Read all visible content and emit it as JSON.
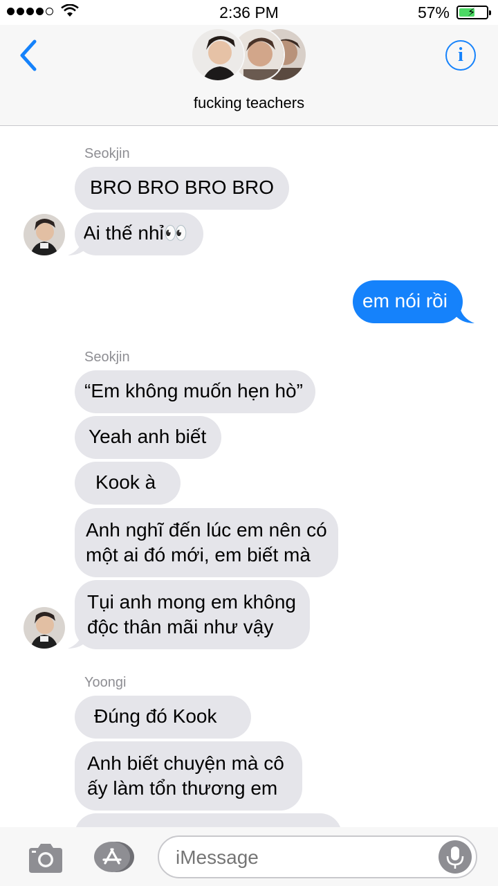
{
  "status_bar": {
    "time": "2:36 PM",
    "battery_percent": "57%",
    "battery_level": 0.57,
    "signal_bars_filled": 4,
    "signal_bars_total": 5
  },
  "header": {
    "group_name": "fucking teachers",
    "back_icon": "chevron-left-icon",
    "info_icon": "info-icon",
    "info_label": "i"
  },
  "thread": {
    "group1": {
      "sender": "Seokjin",
      "messages": [
        "BRO BRO BRO BRO",
        "Ai thế nhỉ👀"
      ]
    },
    "outgoing1": "em nói rồi",
    "group2": {
      "sender": "Seokjin",
      "messages": [
        "“Em không muốn hẹn hò”",
        "Yeah anh biết",
        "Kook à",
        "Anh nghĩ đến lúc em nên có\nmột ai đó mới, em biết mà",
        "Tụi anh mong em không\nđộc thân mãi như vậy"
      ]
    },
    "group3": {
      "sender": "Yoongi",
      "messages": [
        "Đúng đó Kook",
        "Anh biết chuyện mà cô\nấy làm tổn thương em"
      ]
    }
  },
  "input_bar": {
    "placeholder": "iMessage",
    "camera_icon": "camera-icon",
    "apps_icon": "app-store-icon",
    "mic_icon": "microphone-icon"
  },
  "colors": {
    "accent": "#1582fb",
    "incoming_bubble": "#e5e5ea",
    "sender_name": "#8e8e93",
    "battery_fill": "#4cd964"
  }
}
